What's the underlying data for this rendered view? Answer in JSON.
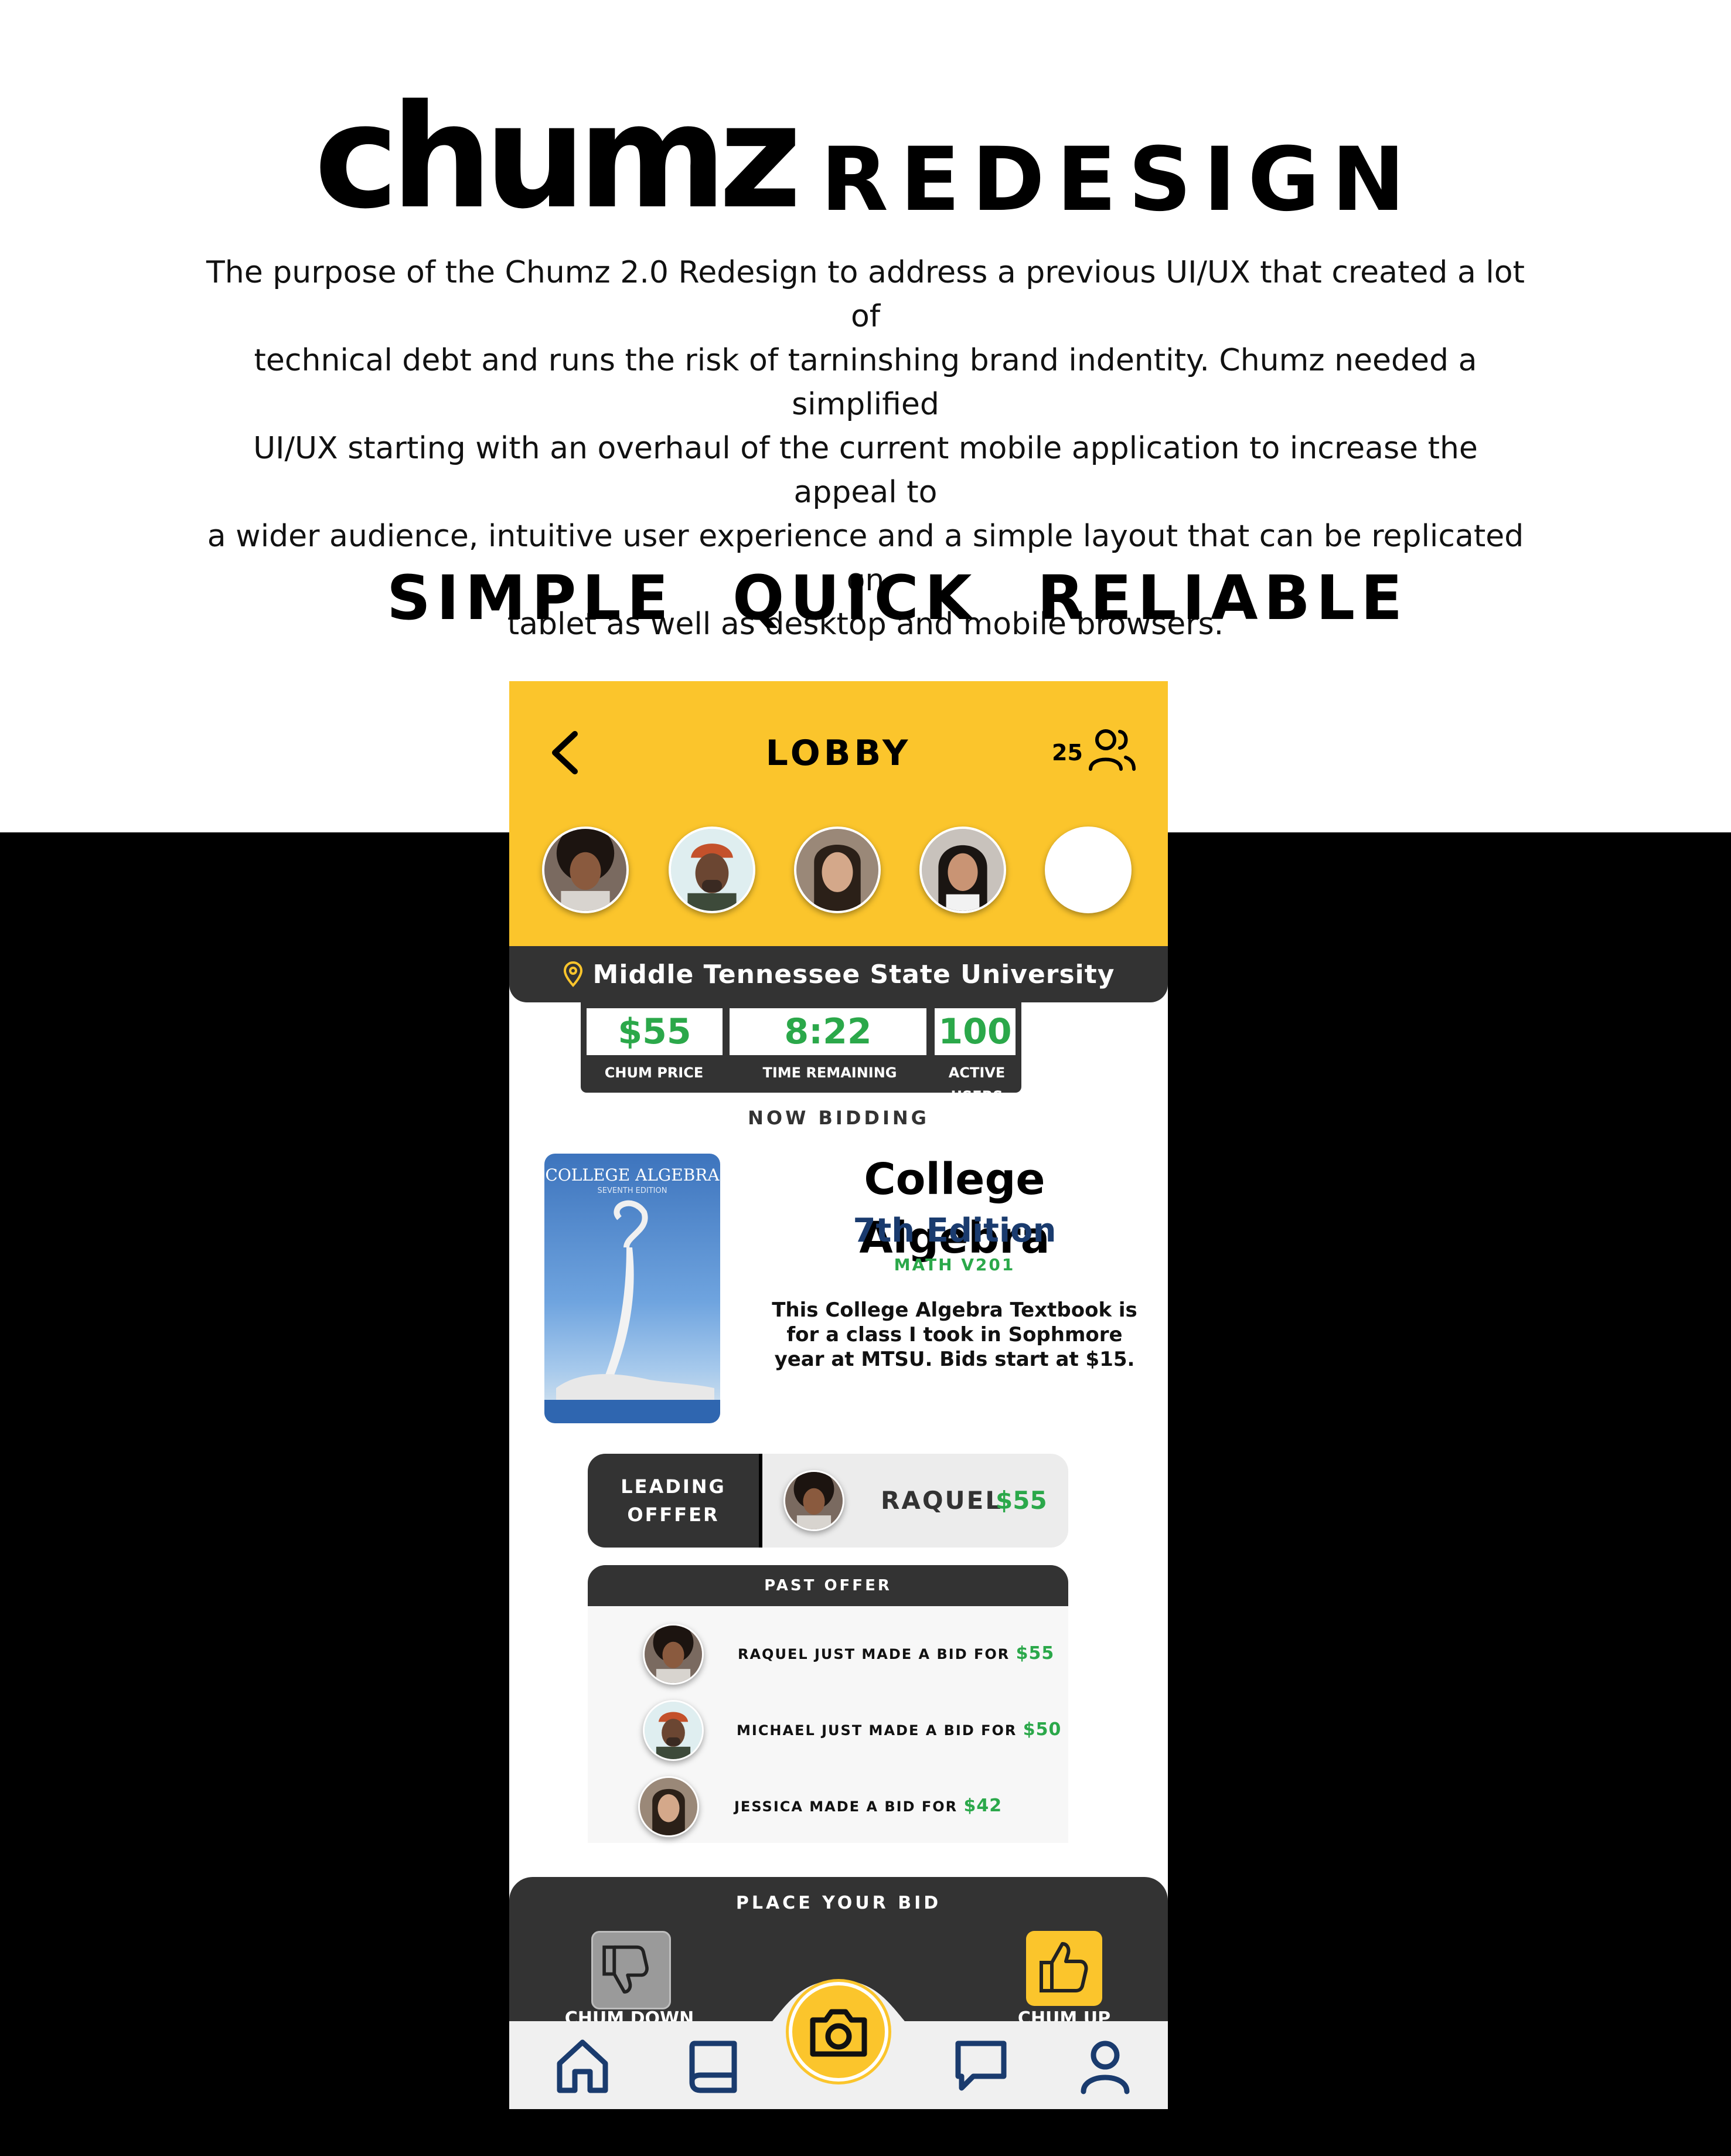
{
  "header": {
    "logo": "chumz",
    "title": "REDESIGN",
    "intro_lines": [
      "The purpose of the Chumz 2.0 Redesign to address a previous UI/UX that created a lot of",
      "technical debt and runs the risk of tarninshing brand indentity. Chumz needed a simplified",
      "UI/UX starting with an overhaul of the current mobile application to increase the appeal to",
      "a wider audience, intuitive user experience and a simple layout that can be replicated on",
      "tablet as well as desktop and mobile browsers."
    ],
    "pillars": [
      "SIMPLE",
      "QUICK",
      "RELIABLE"
    ]
  },
  "colors": {
    "brand_yellow": "#FBC52C",
    "dark": "#333333",
    "money_green": "#2BA84A",
    "edition_blue": "#1a3b6e"
  },
  "app": {
    "title": "LOBBY",
    "back_icon": "chevron-left-icon",
    "users_icon": "users-icon",
    "user_count": "25",
    "location_icon": "map-pin-icon",
    "location": "Middle Tennessee State University",
    "stats": [
      {
        "value": "$55",
        "label": "CHUM PRICE"
      },
      {
        "value": "8:22",
        "label": "TIME REMAINING"
      },
      {
        "value": "100",
        "label": "ACTIVE USERS"
      }
    ],
    "now_bidding": "NOW BIDDING",
    "book_cover": {
      "title": "COLLEGE ALGEBRA",
      "subtitle": "SEVENTH EDITION"
    },
    "product": {
      "title": "College Algebra",
      "edition": "7th Edition",
      "code": "MATH V201",
      "description": "This College Algebra Textbook is for a class I took in Sophmore year at MTSU. Bids start at $15."
    },
    "leading_offer": {
      "label": "LEADING OFFFER",
      "name": "RAQUEL",
      "amount": "$55"
    },
    "past_offer": {
      "title": "PAST OFFER",
      "items": [
        {
          "text": "RAQUEL JUST MADE A BID FOR",
          "amount": "$55"
        },
        {
          "text": "MICHAEL JUST MADE A BID FOR",
          "amount": "$50"
        },
        {
          "text": "JESSICA MADE A BID FOR",
          "amount": "$42"
        }
      ]
    },
    "bid": {
      "title": "PLACE YOUR BID",
      "down_label": "CHUM DOWN",
      "up_label": "CHUM UP"
    },
    "nav": [
      "home-icon",
      "book-icon",
      "camera-icon",
      "chat-icon",
      "profile-icon"
    ]
  }
}
